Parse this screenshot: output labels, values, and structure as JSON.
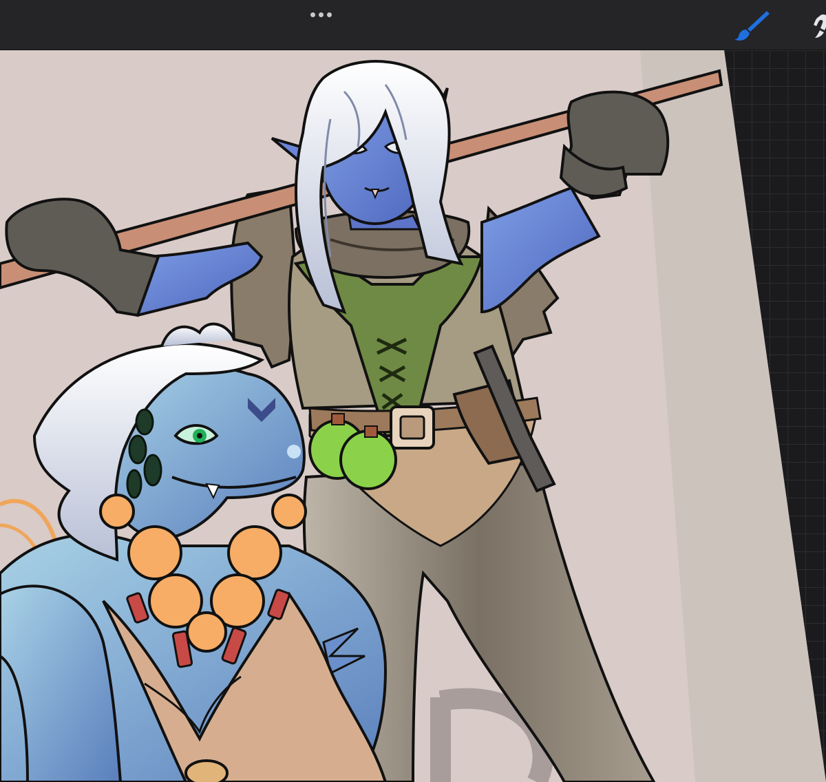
{
  "app": {
    "toolbar": {
      "more_icon": "ellipsis-icon",
      "brush_icon": "paintbrush-icon",
      "smudge_icon": "smudge-icon",
      "active_tool_color": "#1e6fe0"
    },
    "canvas": {
      "background_color": "#d9cbc8",
      "watermark_text": "T D"
    }
  }
}
